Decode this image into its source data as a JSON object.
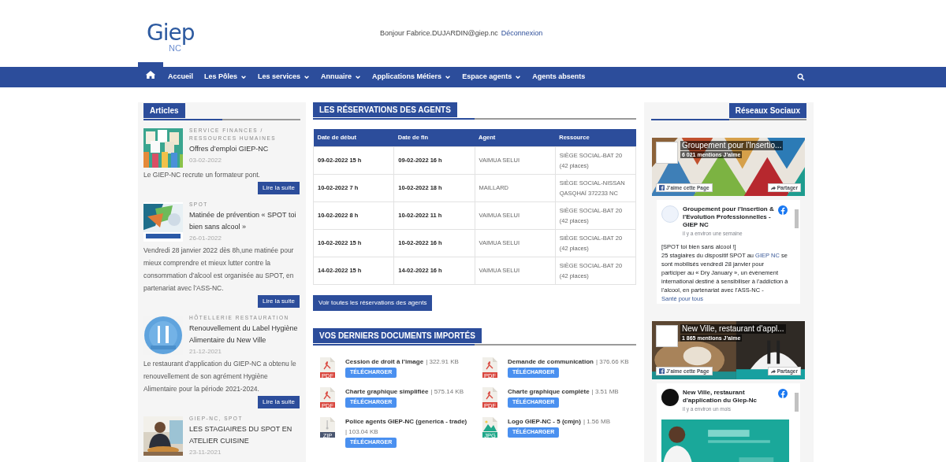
{
  "header": {
    "logo": {
      "main": "Giep",
      "sub": "NC"
    },
    "greeting": "Bonjour Fabrice.DUJARDIN@giep.nc",
    "logout": "Déconnexion"
  },
  "nav": {
    "items": [
      {
        "label": "Accueil",
        "dropdown": false
      },
      {
        "label": "Les Pôles",
        "dropdown": true
      },
      {
        "label": "Les services",
        "dropdown": true
      },
      {
        "label": "Annuaire",
        "dropdown": true
      },
      {
        "label": "Applications Métiers",
        "dropdown": true
      },
      {
        "label": "Espace agents",
        "dropdown": true
      },
      {
        "label": "Agents absents",
        "dropdown": false
      }
    ]
  },
  "articles": {
    "title": "Articles",
    "items": [
      {
        "category": "SERVICE FINANCES / RESSOURCES HUMAINES",
        "title": "Offres d’emploi GIEP-NC",
        "date": "03-02-2022",
        "excerpt": "Le GIEP-NC recrute un formateur pont.",
        "button": "Lire la suite"
      },
      {
        "category": "SPOT",
        "title": "Matinée de prévention « SPOT toi bien sans alcool »",
        "date": "26-01-2022",
        "excerpt": "Vendredi 28 janvier 2022 dès 8h,une matinée pour mieux comprendre et mieux lutter contre la consommation d’alcool est organisée au SPOT, en partenariat avec l’ASS-NC.",
        "button": "Lire la suite"
      },
      {
        "category": "HÔTELLERIE RESTAURATION",
        "title": "Renouvellement du Label Hygiène Alimentaire du New Ville",
        "date": "21-12-2021",
        "excerpt": "Le restaurant d’application du GIEP-NC a obtenu le renouvellement de son agrément Hygiène Alimentaire pour la période 2021-2024.",
        "button": "Lire la suite"
      },
      {
        "category": "GIEP-NC, SPOT",
        "title": "LES STAGIAIRES DU SPOT EN ATELIER CUISINE",
        "date": "23-11-2021"
      }
    ]
  },
  "reservations": {
    "title": "LES RÉSERVATIONS DES AGENTS",
    "columns": [
      "Date de début",
      "Date de fin",
      "Agent",
      "Ressource"
    ],
    "rows": [
      [
        "09-02-2022 15 h",
        "09-02-2022 16 h",
        "VAIMUA SELUI",
        "SIÈGE SOCIAL-BAT 20 (42 places)"
      ],
      [
        "10-02-2022 7 h",
        "10-02-2022 18 h",
        "MAILLARD",
        "SIÈGE SOCIAL-NISSAN QASQHAÏ 372233 NC"
      ],
      [
        "10-02-2022 8 h",
        "10-02-2022 11 h",
        "VAIMUA SELUI",
        "SIÈGE SOCIAL-BAT 20 (42 places)"
      ],
      [
        "10-02-2022 15 h",
        "10-02-2022 16 h",
        "VAIMUA SELUI",
        "SIÈGE SOCIAL-BAT 20 (42 places)"
      ],
      [
        "14-02-2022 15 h",
        "14-02-2022 16 h",
        "VAIMUA SELUI",
        "SIÈGE SOCIAL-BAT 20 (42 places)"
      ]
    ],
    "button": "Voir toutes les réservations des agents"
  },
  "documents": {
    "title": "VOS DERNIERS DOCUMENTS IMPORTÉS",
    "items": [
      {
        "name": "Cession de droit à l’image",
        "size": "| 322.91 KB",
        "type": "PDF",
        "button": "TÉLÉCHARGER"
      },
      {
        "name": "Demande de communication",
        "size": "| 376.66 KB",
        "type": "PDF",
        "button": "TÉLÉCHARGER"
      },
      {
        "name": "Charte graphique simplifiée",
        "size": "| 575.14 KB",
        "type": "PDF",
        "button": "TÉLÉCHARGER"
      },
      {
        "name": "Charte graphique complète",
        "size": "| 3.51 MB",
        "type": "PDF",
        "button": "TÉLÉCHARGER"
      },
      {
        "name": "Police agents GIEP-NC (generica - trade)",
        "size": "| 103.04 KB",
        "type": "ZIP",
        "button": "TÉLÉCHARGER"
      },
      {
        "name": "Logo GIEP-NC - 5 (cmjn)",
        "size": "| 1.56 MB",
        "type": "JPG",
        "button": "TÉLÉCHARGER"
      }
    ]
  },
  "social": {
    "title": "Réseaux Sociaux",
    "widgets": [
      {
        "page_name": "Groupement pour l'Insertio...",
        "likes": "6 021 mentions J’aime",
        "like_button": "J’aime cette Page",
        "share_button": "Partager",
        "post": {
          "author": "Groupement pour l'Insertion & l'Evolution Professionnelles - GIEP NC",
          "time": "il y a environ une semaine",
          "headline": "[SPOT toi bien sans alcool !]",
          "text": [
            {
              "text": "25 stagiaires du dispositif SPOT au ",
              "link": false
            },
            {
              "text": "GIEP NC",
              "link": true
            },
            {
              "text": " se sont mobilisés vendredi 28 janvier pour participer au « Dry January », un évènement international destiné à sensibiliser à l’addiction à l’alcool, en partenariat avec l’ASS-NC - ",
              "link": false
            },
            {
              "text": "Santé pour tous",
              "link": true
            }
          ]
        }
      },
      {
        "page_name": "New Ville, restaurant d'appl...",
        "likes": "1 865 mentions J’aime",
        "like_button": "J’aime cette Page",
        "share_button": "Partager",
        "post": {
          "author": "New Ville, restaurant d'application du Giep-Nc",
          "time": "il y a environ un mois",
          "picture": true
        }
      }
    ]
  }
}
